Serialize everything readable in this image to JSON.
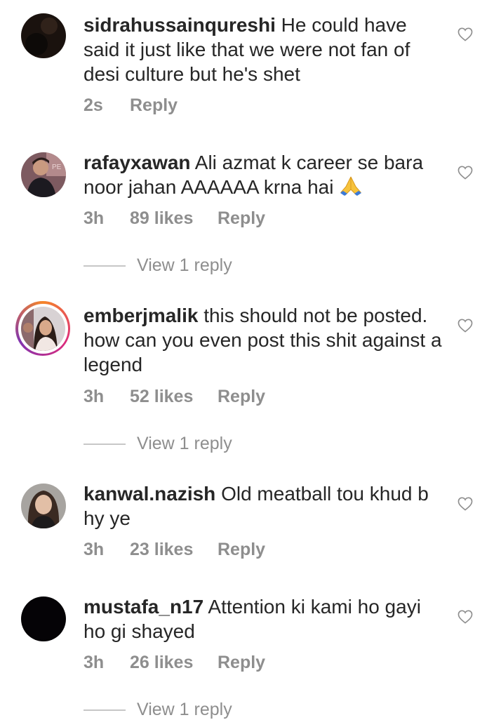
{
  "comments": [
    {
      "username": "sidrahussainqureshi",
      "text": "He could have said it just like that we were not fan of desi culture but he's shet",
      "time": "2s",
      "likes": "",
      "reply_label": "Reply",
      "view_replies": ""
    },
    {
      "username": "rafayxawan",
      "text": "Ali azmat k career se bara noor jahan AAAAAA krna hai",
      "time": "3h",
      "likes": "89 likes",
      "reply_label": "Reply",
      "view_replies": "View 1 reply"
    },
    {
      "username": "emberjmalik",
      "text": "this should not be posted. how can you even post this shit against a legend",
      "time": "3h",
      "likes": "52 likes",
      "reply_label": "Reply",
      "view_replies": "View 1 reply"
    },
    {
      "username": "kanwal.nazish",
      "text": "Old meatball tou khud b hy ye",
      "time": "3h",
      "likes": "23 likes",
      "reply_label": "Reply",
      "view_replies": ""
    },
    {
      "username": "mustafa_n17",
      "text": "Attention ki kami ho gayi ho gi shayed",
      "time": "3h",
      "likes": "26 likes",
      "reply_label": "Reply",
      "view_replies": "View 1 reply"
    }
  ],
  "icons": {
    "like": "heart-outline-icon",
    "emoji": "folded-hands-emoji"
  },
  "colors": {
    "text": "#262626",
    "secondary": "#8e8e8e",
    "divider": "#c7c7c7"
  }
}
